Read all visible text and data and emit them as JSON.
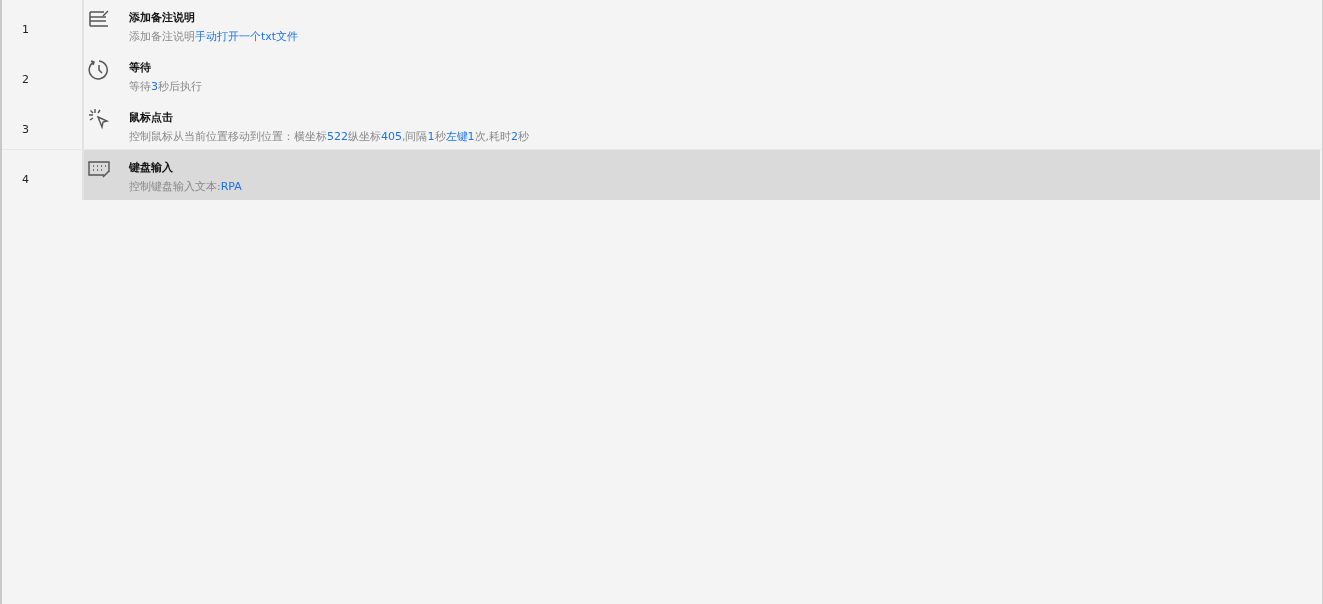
{
  "steps": [
    {
      "number": "1",
      "kind": "note",
      "title": "添加备注说明",
      "selected": false,
      "description": [
        {
          "text": "添加备注说明",
          "highlight": false
        },
        {
          "text": "手动打开一个txt文件",
          "highlight": true
        }
      ]
    },
    {
      "number": "2",
      "kind": "wait",
      "title": "等待",
      "selected": false,
      "description": [
        {
          "text": "等待",
          "highlight": false
        },
        {
          "text": "3",
          "highlight": true
        },
        {
          "text": "秒后执行",
          "highlight": false
        }
      ]
    },
    {
      "number": "3",
      "kind": "click",
      "title": "鼠标点击",
      "selected": false,
      "description": [
        {
          "text": "控制鼠标从当前位置移动到位置：横坐标",
          "highlight": false
        },
        {
          "text": "522",
          "highlight": true
        },
        {
          "text": "纵坐标",
          "highlight": false
        },
        {
          "text": "405",
          "highlight": true
        },
        {
          "text": ",间隔",
          "highlight": false
        },
        {
          "text": "1",
          "highlight": true
        },
        {
          "text": "秒",
          "highlight": false
        },
        {
          "text": "左键",
          "highlight": true
        },
        {
          "text": "1",
          "highlight": true
        },
        {
          "text": "次,耗时",
          "highlight": false
        },
        {
          "text": "2",
          "highlight": true
        },
        {
          "text": "秒",
          "highlight": false
        }
      ]
    },
    {
      "number": "4",
      "kind": "keyboard",
      "title": "键盘输入",
      "selected": true,
      "description": [
        {
          "text": "控制键盘输入文本:",
          "highlight": false
        },
        {
          "text": "RPA",
          "highlight": true
        }
      ]
    }
  ]
}
